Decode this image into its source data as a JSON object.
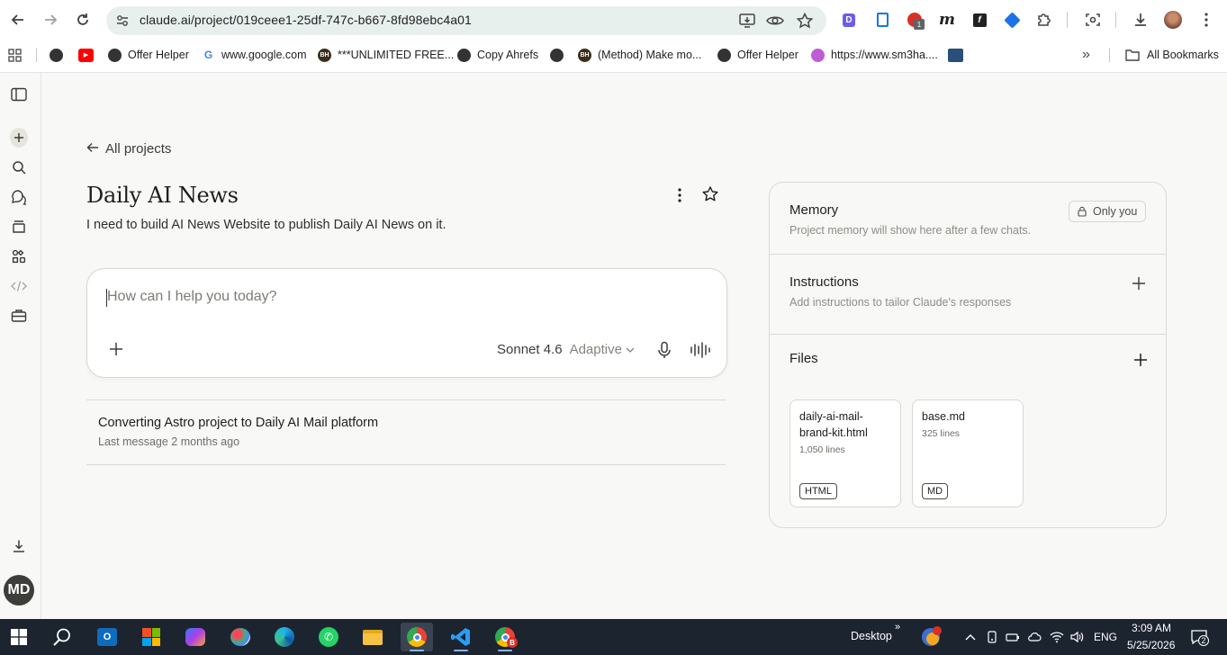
{
  "browser": {
    "url": "claude.ai/project/019ceee1-25df-747c-b667-8fd98ebc4a01",
    "bookmarks": [
      {
        "label": "",
        "icon": "globe-icon"
      },
      {
        "label": "",
        "icon": "youtube-icon"
      },
      {
        "label": "Offer Helper",
        "icon": "globe-icon"
      },
      {
        "label": "www.google.com",
        "icon": "google-icon"
      },
      {
        "label": "***UNLIMITED FREE...",
        "icon": "bhw-icon"
      },
      {
        "label": "Copy Ahrefs",
        "icon": "globe-icon"
      },
      {
        "label": "",
        "icon": "globe-icon"
      },
      {
        "label": "(Method) Make mo...",
        "icon": "bhw-icon"
      },
      {
        "label": "Offer Helper",
        "icon": "globe-icon"
      },
      {
        "label": "https://www.sm3ha....",
        "icon": "site-icon"
      }
    ],
    "overflow_label": "»",
    "all_bookmarks_label": "All Bookmarks",
    "extension_badge": "1"
  },
  "sidebar": {
    "avatar_initials": "MD"
  },
  "project": {
    "back_label": "All projects",
    "title": "Daily AI News",
    "description": "I need to build AI News Website to publish Daily AI News on it."
  },
  "composer": {
    "placeholder": "How can I help you today?",
    "model": "Sonnet 4.6",
    "mode": "Adaptive"
  },
  "chats": [
    {
      "title": "Converting Astro project to Daily AI Mail platform",
      "meta": "Last message 2 months ago"
    }
  ],
  "panel": {
    "memory": {
      "title": "Memory",
      "subtitle": "Project memory will show here after a few chats.",
      "visibility": "Only you"
    },
    "instructions": {
      "title": "Instructions",
      "subtitle": "Add instructions to tailor Claude's responses"
    },
    "files": {
      "title": "Files",
      "items": [
        {
          "name": "daily-ai-mail-brand-kit.html",
          "lines": "1,050 lines",
          "type": "HTML"
        },
        {
          "name": "base.md",
          "lines": "325 lines",
          "type": "MD"
        }
      ]
    }
  },
  "taskbar": {
    "desktop_label": "Desktop",
    "language": "ENG",
    "time": "3:09 AM",
    "date": "5/25/2026",
    "notification_count": "2",
    "chrome_profile_badge": "B"
  },
  "colors": {
    "page_bg": "#f8f8f6",
    "taskbar_bg": "#1c2430",
    "omnibox_bg": "#e8f0ee",
    "accent_border": "#dcdad3"
  }
}
